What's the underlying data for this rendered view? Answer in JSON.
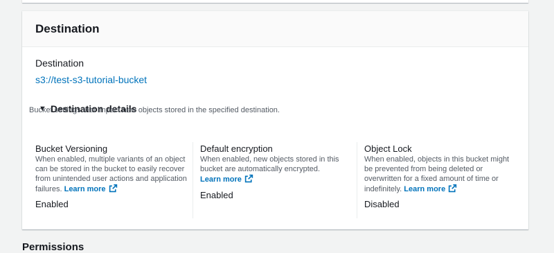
{
  "panel": {
    "title": "Destination",
    "destination_label": "Destination",
    "destination_link": "s3://test-s3-tutorial-bucket"
  },
  "details": {
    "title": "Destination details",
    "description": "Bucket settings that impact new objects stored in the specified destination.",
    "columns": [
      {
        "title": "Bucket Versioning",
        "description": "When enabled, multiple variants of an object can be stored in the bucket to easily recover from unintended user actions and application failures.",
        "learn_more": "Learn more",
        "status": "Enabled"
      },
      {
        "title": "Default encryption",
        "description": "When enabled, new objects stored in this bucket are automatically encrypted.",
        "learn_more": "Learn more",
        "status": "Enabled"
      },
      {
        "title": "Object Lock",
        "description": "When enabled, objects in this bucket might be prevented from being deleted or overwritten for a fixed amount of time or indefinitely.",
        "learn_more": "Learn more",
        "status": "Disabled"
      }
    ]
  },
  "next_section": {
    "title": "Permissions"
  },
  "icons": {
    "caret": "caret-down-icon",
    "external": "external-link-icon"
  },
  "colors": {
    "link": "#0073bb",
    "text": "#16191f",
    "muted": "#545b64",
    "background": "#f2f3f3"
  }
}
